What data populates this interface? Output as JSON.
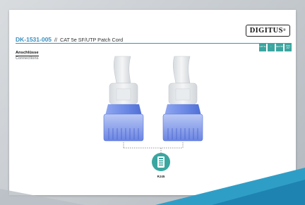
{
  "brand": {
    "name": "DIGITUS",
    "mark": "®"
  },
  "product": {
    "code": "DK-1531-005",
    "separator": "//",
    "name": "CAT 5e SF/UTP Patch Cord"
  },
  "section": {
    "title_de": "Anschlüsse",
    "title_en": "Connections"
  },
  "badges": [
    {
      "label": "CAT 5e"
    },
    {
      "label": "↕"
    },
    {
      "label": "SF/UTP"
    },
    {
      "label": "AWG 26/7"
    }
  ],
  "connector": {
    "label": "RJ45",
    "icon": "rj45-port-icon"
  },
  "colors": {
    "accent_blue": "#3a8fc0",
    "teal": "#3aa6a0",
    "boot": "#5a78d8"
  }
}
